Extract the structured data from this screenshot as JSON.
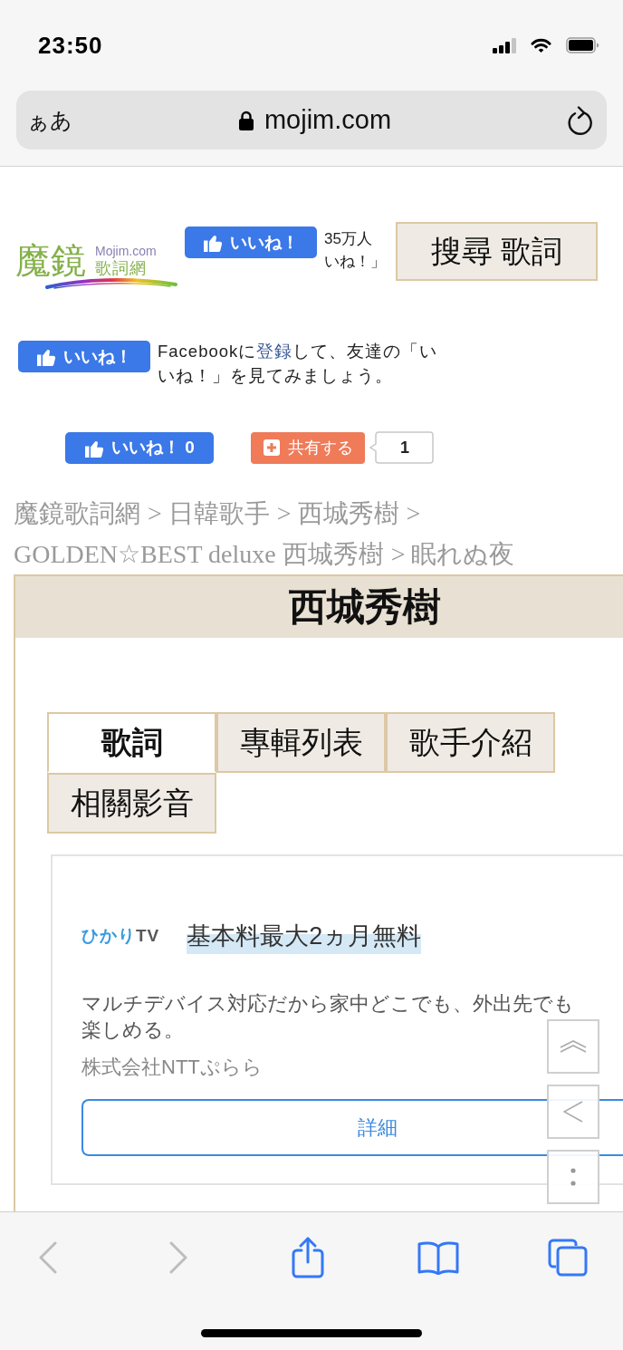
{
  "status_bar": {
    "time": "23:50"
  },
  "address_bar": {
    "text_size_button": "ぁあ",
    "url": "mojim.com"
  },
  "site_header": {
    "logo": {
      "title": "魔鏡",
      "domain": "Mojim.com",
      "subtitle": "歌詞網"
    },
    "like_button": "いいね！",
    "like_count_lines": [
      "35万人",
      "いね！」"
    ],
    "search_button": "搜尋 歌詞"
  },
  "facebook_prompt": {
    "like_button": "いいね！",
    "text_before": "Facebookに",
    "link": "登録",
    "text_after": "して、友達の「いいね！」を見てみましょう。"
  },
  "share_row": {
    "like_button": {
      "label": "いいね！",
      "count": "0"
    },
    "share_button": "共有する",
    "share_count": "1"
  },
  "breadcrumb": [
    {
      "kind": "link",
      "text": "魔鏡歌詞網"
    },
    {
      "kind": "separator",
      "text": ">"
    },
    {
      "kind": "link",
      "text": "日韓歌手"
    },
    {
      "kind": "separator",
      "text": ">"
    },
    {
      "kind": "link",
      "text": "西城秀樹"
    },
    {
      "kind": "separator",
      "text": ">"
    },
    {
      "kind": "link",
      "text": "GOLDEN☆BEST deluxe 西城秀樹"
    },
    {
      "kind": "separator",
      "text": ">"
    },
    {
      "kind": "link",
      "text": "眠れぬ夜"
    }
  ],
  "artist_panel": {
    "title": "西城秀樹",
    "tabs": [
      {
        "label": "歌詞",
        "selected": true
      },
      {
        "label": "專輯列表",
        "selected": false
      },
      {
        "label": "歌手介紹",
        "selected": false
      },
      {
        "label": "相關影音",
        "selected": false
      }
    ]
  },
  "ad": {
    "brand": [
      {
        "text": "ひかり",
        "color": "#3b9be0"
      },
      {
        "text": "TV",
        "color": "#585858"
      }
    ],
    "headline": "基本料最大2ヵ月無料",
    "description": "マルチデバイス対応だから家中どこでも、外出先でも楽しめる。",
    "advertiser": "株式会社NTTぷらら",
    "button": "詳細"
  },
  "floating_buttons": [
    {
      "kind": "scroll_top"
    },
    {
      "kind": "back"
    },
    {
      "kind": "more"
    }
  ],
  "toolbar": {
    "buttons": [
      {
        "kind": "back",
        "disabled": true
      },
      {
        "kind": "forward",
        "disabled": true
      },
      {
        "kind": "share",
        "disabled": false
      },
      {
        "kind": "bookmarks",
        "disabled": false
      },
      {
        "kind": "tabs",
        "disabled": false
      }
    ]
  }
}
